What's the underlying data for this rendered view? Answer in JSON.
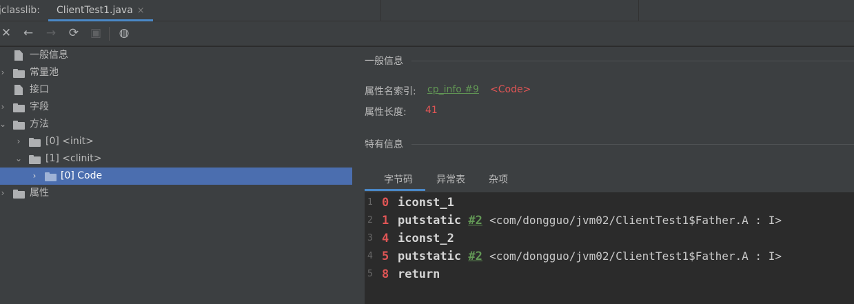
{
  "tabs": {
    "jclasslib_label": "jclasslib:",
    "active_file": "ClientTest1.java",
    "close_glyph": "×"
  },
  "toolbar": {
    "close": "✕",
    "back": "←",
    "forward": "→",
    "refresh": "⟳",
    "save": "▣",
    "web": "◍"
  },
  "tree": {
    "items": [
      {
        "label": "一般信息",
        "icon": "file-icon"
      },
      {
        "label": "常量池",
        "icon": "folder-icon"
      },
      {
        "label": "接口",
        "icon": "file-icon"
      },
      {
        "label": "字段",
        "icon": "folder-icon"
      },
      {
        "label": "方法",
        "icon": "folder-icon"
      },
      {
        "label": "[0] <init>",
        "icon": "folder-icon"
      },
      {
        "label": "[1] <clinit>",
        "icon": "folder-icon"
      },
      {
        "label": "[0] Code",
        "icon": "folder-icon"
      },
      {
        "label": "属性",
        "icon": "folder-icon"
      }
    ],
    "chevron_collapsed": "›",
    "chevron_expanded": "⌄"
  },
  "general": {
    "title": "一般信息",
    "name_index_label": "属性名索引:",
    "name_index_link": "cp_info #9",
    "name_index_value": "<Code>",
    "length_label": "属性长度:",
    "length_value": "41"
  },
  "specific": {
    "title": "特有信息",
    "tabs": [
      "字节码",
      "异常表",
      "杂项"
    ]
  },
  "bytecode": [
    {
      "line": "1",
      "offset": "0",
      "op": "iconst_1",
      "ref": "",
      "desc": ""
    },
    {
      "line": "2",
      "offset": "1",
      "op": "putstatic",
      "ref": "#2",
      "desc": "<com/dongguo/jvm02/ClientTest1$Father.A : I>"
    },
    {
      "line": "3",
      "offset": "4",
      "op": "iconst_2",
      "ref": "",
      "desc": ""
    },
    {
      "line": "4",
      "offset": "5",
      "op": "putstatic",
      "ref": "#2",
      "desc": "<com/dongguo/jvm02/ClientTest1$Father.A : I>"
    },
    {
      "line": "5",
      "offset": "8",
      "op": "return",
      "ref": "",
      "desc": ""
    }
  ],
  "colors": {
    "selection": "#4b6eaf",
    "accent": "#4a88c7",
    "link_green": "#629755",
    "value_red": "#e05555"
  }
}
